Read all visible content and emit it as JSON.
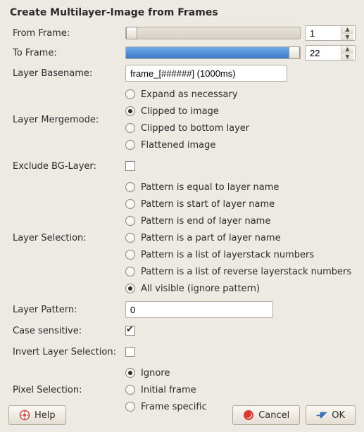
{
  "title": "Create Multilayer-Image from Frames",
  "fields": {
    "from_frame": {
      "label": "From Frame:",
      "value": "1"
    },
    "to_frame": {
      "label": "To Frame:",
      "value": "22"
    },
    "layer_basename": {
      "label": "Layer Basename:",
      "value": "frame_[######] (1000ms)"
    },
    "layer_mergemode": {
      "label": "Layer Mergemode:",
      "options": [
        "Expand as necessary",
        "Clipped to image",
        "Clipped to bottom layer",
        "Flattened image"
      ],
      "selected_index": 1
    },
    "exclude_bg_layer": {
      "label": "Exclude BG-Layer:",
      "checked": false
    },
    "layer_selection": {
      "label": "Layer Selection:",
      "options": [
        "Pattern is equal to layer name",
        "Pattern is start of layer name",
        "Pattern is end of layer name",
        "Pattern is a part of layer name",
        "Pattern is a list of layerstack numbers",
        "Pattern is a list of reverse layerstack numbers",
        "All visible (ignore pattern)"
      ],
      "selected_index": 6
    },
    "layer_pattern": {
      "label": "Layer Pattern:",
      "value": "0"
    },
    "case_sensitive": {
      "label": "Case sensitive:",
      "checked": true
    },
    "invert_layer_selection": {
      "label": "Invert Layer Selection:",
      "checked": false
    },
    "pixel_selection": {
      "label": "Pixel Selection:",
      "options": [
        "Ignore",
        "Initial frame",
        "Frame specific"
      ],
      "selected_index": 0
    }
  },
  "buttons": {
    "help": "Help",
    "cancel": "Cancel",
    "ok": "OK"
  }
}
